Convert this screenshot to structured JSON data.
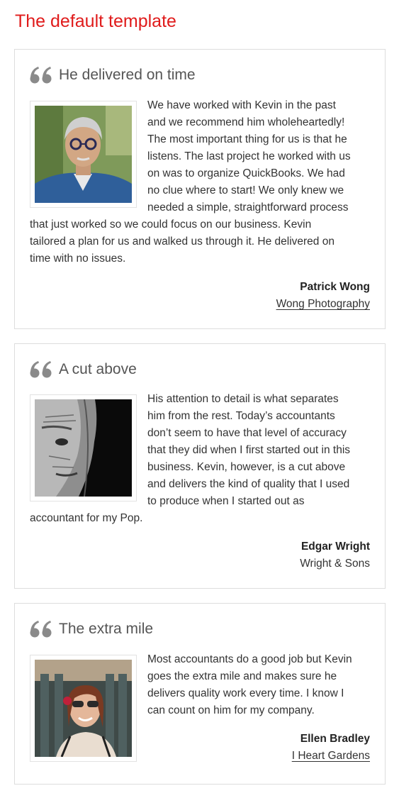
{
  "page": {
    "title": "The default template"
  },
  "testimonials": [
    {
      "title": "He delivered on time",
      "text_lines": [
        "We have worked with Kevin in the past",
        "and we recommend him wholeheartedly!",
        "The most important thing for us is that he",
        "listens. The last project he worked with us",
        "on was to organize QuickBooks. We had",
        "no clue where to start! We only knew we",
        "needed a simple, straightforward process",
        "that just worked so we could focus on our business. Kevin",
        "tailored a plan for us and walked us through it. He delivered on",
        "time with no issues."
      ],
      "author": "Patrick Wong",
      "company": "Wong Photography",
      "company_linked": true
    },
    {
      "title": "A cut above",
      "text_lines": [
        "His attention to detail is what separates",
        "him from the rest. Today’s accountants",
        "don’t seem to have that level of accuracy",
        "that they did when I first started out in this",
        "business. Kevin, however, is a cut above",
        "and delivers the kind of quality that I used",
        "to produce when I started out as",
        "accountant for my Pop."
      ],
      "author": "Edgar Wright",
      "company": "Wright & Sons",
      "company_linked": false
    },
    {
      "title": "The extra mile",
      "text_lines": [
        "Most accountants do a good job but Kevin",
        "goes the extra mile and makes sure he",
        "delivers quality work every time. I know I",
        "can count on him for my company."
      ],
      "author": "Ellen Bradley",
      "company": "I Heart Gardens",
      "company_linked": true
    }
  ],
  "colors": {
    "title_red": "#e01b1b",
    "quote_icon_gray": "#8a8a8a",
    "card_border": "#dddddd",
    "text": "#333333"
  },
  "icons": {
    "quote": "double-quote-icon"
  }
}
